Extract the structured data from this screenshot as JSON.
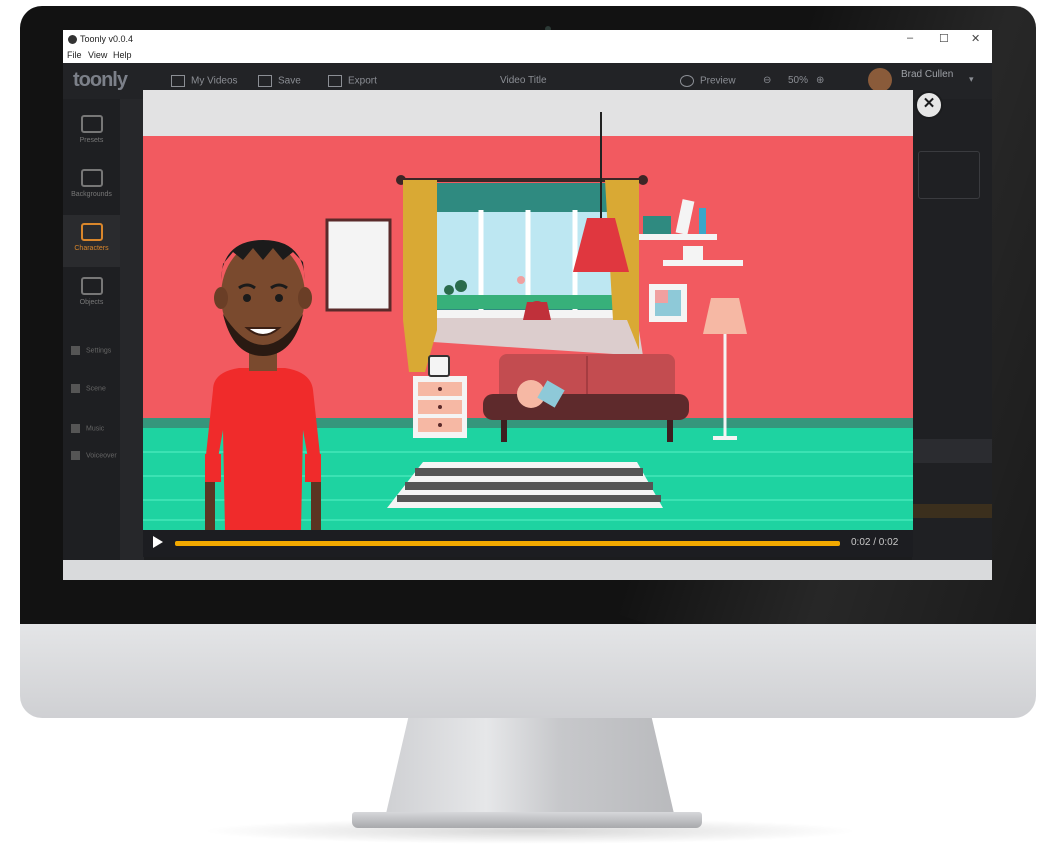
{
  "window": {
    "title": "Toonly v0.0.4",
    "controls": {
      "minimize": "–",
      "maximize": "☐",
      "close": "✕"
    }
  },
  "menu": {
    "items": [
      "File",
      "View",
      "Help"
    ]
  },
  "app": {
    "logo": "toonly",
    "toolbar": {
      "my_videos": "My Videos",
      "save": "Save",
      "export": "Export",
      "video_title": "Video Title",
      "preview": "Preview",
      "zoom": "50%"
    },
    "user": {
      "name": "Brad Cullen"
    }
  },
  "sidebar": {
    "items": [
      "Presets",
      "Backgrounds",
      "Characters",
      "Objects"
    ],
    "active": "Characters",
    "bottom_items": [
      "Settings",
      "Scene",
      "Music",
      "Voiceover"
    ]
  },
  "player": {
    "close_glyph": "✕",
    "progress": 1.0,
    "time": "0:02 / 0:02"
  },
  "colors": {
    "wall": "#f25a60",
    "floor": "#1ed3a1",
    "accent": "#f2a900",
    "shirt": "#f02b2b"
  }
}
